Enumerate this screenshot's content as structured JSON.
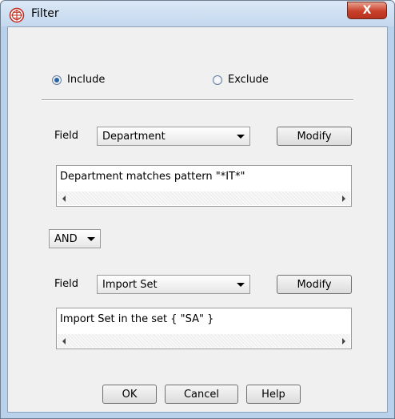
{
  "window": {
    "title": "Filter",
    "close_label": "X"
  },
  "mode": {
    "include_label": "Include",
    "exclude_label": "Exclude",
    "selected": "Include"
  },
  "condition1": {
    "field_label": "Field",
    "field_value": "Department",
    "modify_label": "Modify",
    "expression": "Department matches pattern \"*IT*\""
  },
  "operator": {
    "value": "AND"
  },
  "condition2": {
    "field_label": "Field",
    "field_value": "Import Set",
    "modify_label": "Modify",
    "expression": "Import Set in the set { \"SA\" }"
  },
  "buttons": {
    "ok": "OK",
    "cancel": "Cancel",
    "help": "Help"
  },
  "colors": {
    "title_bar": "#c4d8ee",
    "close": "#c8402a",
    "radio_accent": "#2a64a8"
  }
}
